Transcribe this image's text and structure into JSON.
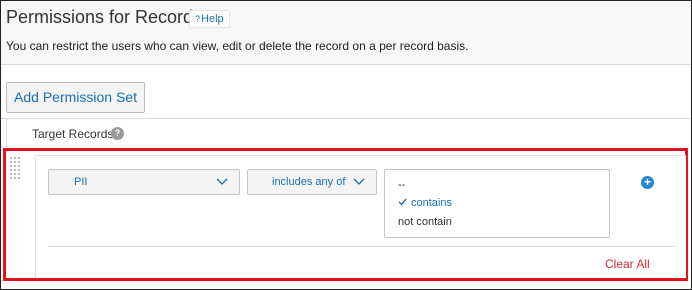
{
  "header": {
    "title": "Permissions for Records",
    "help_label": "Help",
    "help_icon": "question-mark-icon",
    "description": "You can restrict the users who can view, edit or delete the record on a per record basis."
  },
  "toolbar": {
    "add_permission_set_label": "Add Permission Set"
  },
  "target_records": {
    "label": "Target Records",
    "info_icon": "question-circle-icon",
    "info_glyph": "?"
  },
  "rule": {
    "field_value": "PII",
    "operator_value": "includes any of",
    "value_options": [
      {
        "label": "--",
        "selected": false
      },
      {
        "label": "contains",
        "selected": true
      },
      {
        "label": "not contain",
        "selected": false
      }
    ],
    "add_icon": "plus-circle-icon",
    "clear_all_label": "Clear All"
  },
  "colors": {
    "accent": "#1a6fb3",
    "highlight_border": "#e0141e",
    "clear_all": "#c9302c",
    "add_icon_bg": "#2a86d0"
  }
}
